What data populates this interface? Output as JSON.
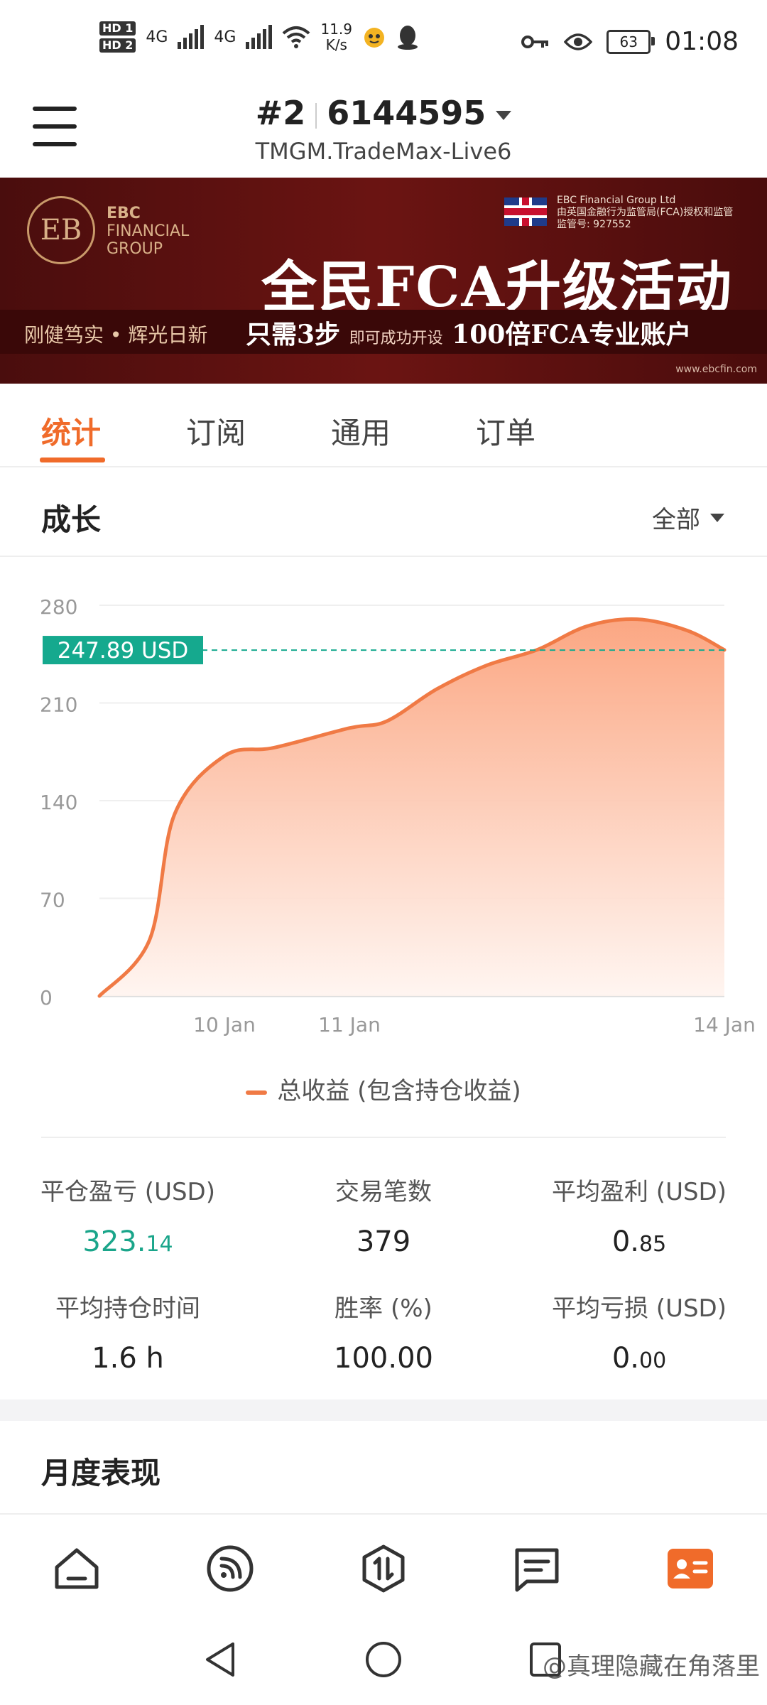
{
  "status_bar": {
    "hd_labels": [
      "HD 1",
      "HD 2"
    ],
    "network_1": "4G",
    "network_2": "4G",
    "speed_value": "11.9",
    "speed_unit": "K/s",
    "battery": "63",
    "time": "01:08"
  },
  "header": {
    "account_rank": "#2",
    "account_number": "6144595",
    "server": "TMGM.TradeMax-Live6"
  },
  "banner": {
    "logo_line1": "EBC",
    "logo_line2": "FINANCIAL",
    "logo_line3": "GROUP",
    "reg_line1": "EBC Financial Group Ltd",
    "reg_line2": "由英国金融行为监管局(FCA)授权和监管",
    "reg_line3": "监管号: 927552",
    "headline": "全民FCA升级活动",
    "left_slogan": "刚健笃实 • 辉光日新",
    "steps_prefix": "只需3步",
    "steps_small": "即可成功开设",
    "steps_suffix": "100倍FCA专业账户",
    "url": "www.ebcfin.com"
  },
  "tabs": [
    "统计",
    "订阅",
    "通用",
    "订单"
  ],
  "growth": {
    "title": "成长",
    "filter": "全部"
  },
  "chart_data": {
    "type": "area",
    "y_ticks": [
      "280",
      "210",
      "140",
      "70",
      "0"
    ],
    "ylim": [
      0,
      280
    ],
    "x_tick_labels": [
      "10 Jan",
      "11 Jan",
      "14 Jan"
    ],
    "x": [
      "9 Jan",
      "9.4 Jan",
      "9.6 Jan",
      "10 Jan",
      "10.4 Jan",
      "11 Jan",
      "11.3 Jan",
      "11.7 Jan",
      "12.1 Jan",
      "12.5 Jan",
      "12.9 Jan",
      "13.3 Jan",
      "13.7 Jan",
      "14 Jan"
    ],
    "values": [
      0,
      40,
      130,
      172,
      178,
      192,
      197,
      220,
      237,
      248,
      265,
      270,
      262,
      248
    ],
    "current_label": "247.89 USD",
    "current_value": 247.89,
    "series_name": "总收益 (包含持仓收益)",
    "colors": {
      "line": "#f07a45",
      "fill": "#fbb392",
      "marker": "#15a98e"
    }
  },
  "stats": {
    "closed_pl_label": "平仓盈亏 (USD)",
    "closed_pl_int": "323.",
    "closed_pl_dec": "14",
    "trades_label": "交易笔数",
    "trades_value": "379",
    "avg_profit_label": "平均盈利 (USD)",
    "avg_profit_int": "0.",
    "avg_profit_dec": "85",
    "avg_hold_label": "平均持仓时间",
    "avg_hold_value": "1.6 h",
    "win_rate_label": "胜率 (%)",
    "win_rate_value": "100.00",
    "avg_loss_label": "平均亏损 (USD)",
    "avg_loss_int": "0.",
    "avg_loss_dec": "00"
  },
  "monthly": {
    "title": "月度表现"
  },
  "bottom_nav": [
    "home-icon",
    "feed-icon",
    "trade-icon",
    "message-icon",
    "profile-card-icon"
  ],
  "watermark": "@真理隐藏在角落里"
}
